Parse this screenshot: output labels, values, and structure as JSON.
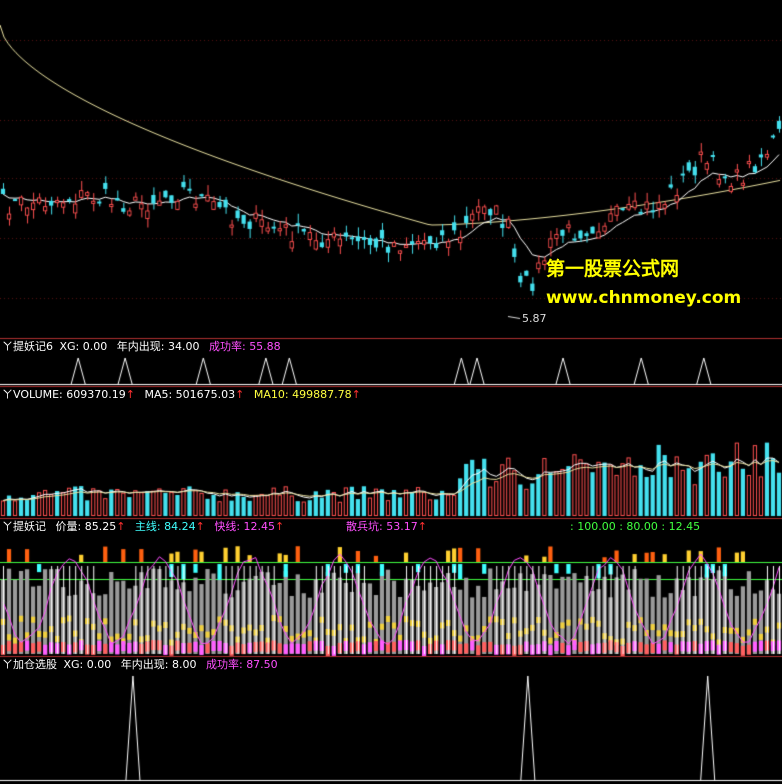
{
  "colors": {
    "background": "#000000",
    "up": "#ff5050",
    "down": "#44e0ee",
    "ma_yellow": "#e8e0a0",
    "ma_white": "#ffffff",
    "divider": "#b03030",
    "white_text": "#ffffff",
    "yellow_text": "#ffff40",
    "magenta_text": "#ff50ff",
    "cyan_text": "#40ffff",
    "arrow_red": "#ff3030"
  },
  "watermark": {
    "title": "第一股票公式网",
    "url": "www.chnmoney.com"
  },
  "price_panel": {
    "low_marker": "5.87"
  },
  "panel1": {
    "title": "ㄚ提妖记6",
    "xg": "XG: 0.00",
    "appear": "年内出现: 34.00",
    "success_label": "成功率:",
    "success_value": "55.88"
  },
  "panel2": {
    "title": "ㄚVOLUME: 609370.19",
    "ma5": "MA5: 501675.03",
    "ma10": "MA10: 499887.78",
    "arrow": "↑"
  },
  "panel3": {
    "title": "ㄚ提妖记",
    "price": "价量: 85.25",
    "main": "主线: 84.24",
    "fast": "快线: 12.45",
    "pit": "散兵坑: 53.17",
    "levels": ": 100.00  : 80.00  : 12.45",
    "arrow": "↑"
  },
  "panel4": {
    "title": "ㄚ加仓选股",
    "xg": "XG: 0.00",
    "appear": "年内出现: 8.00",
    "success_label": "成功率:",
    "success_value": "87.50"
  },
  "chart_data": [
    {
      "type": "candlestick",
      "name": "price",
      "low_label": 5.87,
      "ma_long_shape": "declining then flattening then rising",
      "ma_short_shape": "tracks price"
    },
    {
      "type": "line",
      "name": "ㄚ提妖记6 signal",
      "signal_positions_fraction": [
        0.1,
        0.16,
        0.26,
        0.34,
        0.37,
        0.59,
        0.61,
        0.72,
        0.82,
        0.9
      ]
    },
    {
      "type": "bar",
      "name": "VOLUME",
      "last_value": 609370.19,
      "ma5": 501675.03,
      "ma10": 499887.78
    },
    {
      "type": "bar",
      "name": "ㄚ提妖记",
      "price_volume": 85.25,
      "main_line": 84.24,
      "fast_line": 12.45,
      "pit": 53.17,
      "levels": [
        100.0,
        80.0,
        12.45
      ]
    },
    {
      "type": "line",
      "name": "ㄚ加仓选股 signal",
      "signal_positions_fraction": [
        0.17,
        0.675,
        0.905
      ]
    }
  ]
}
